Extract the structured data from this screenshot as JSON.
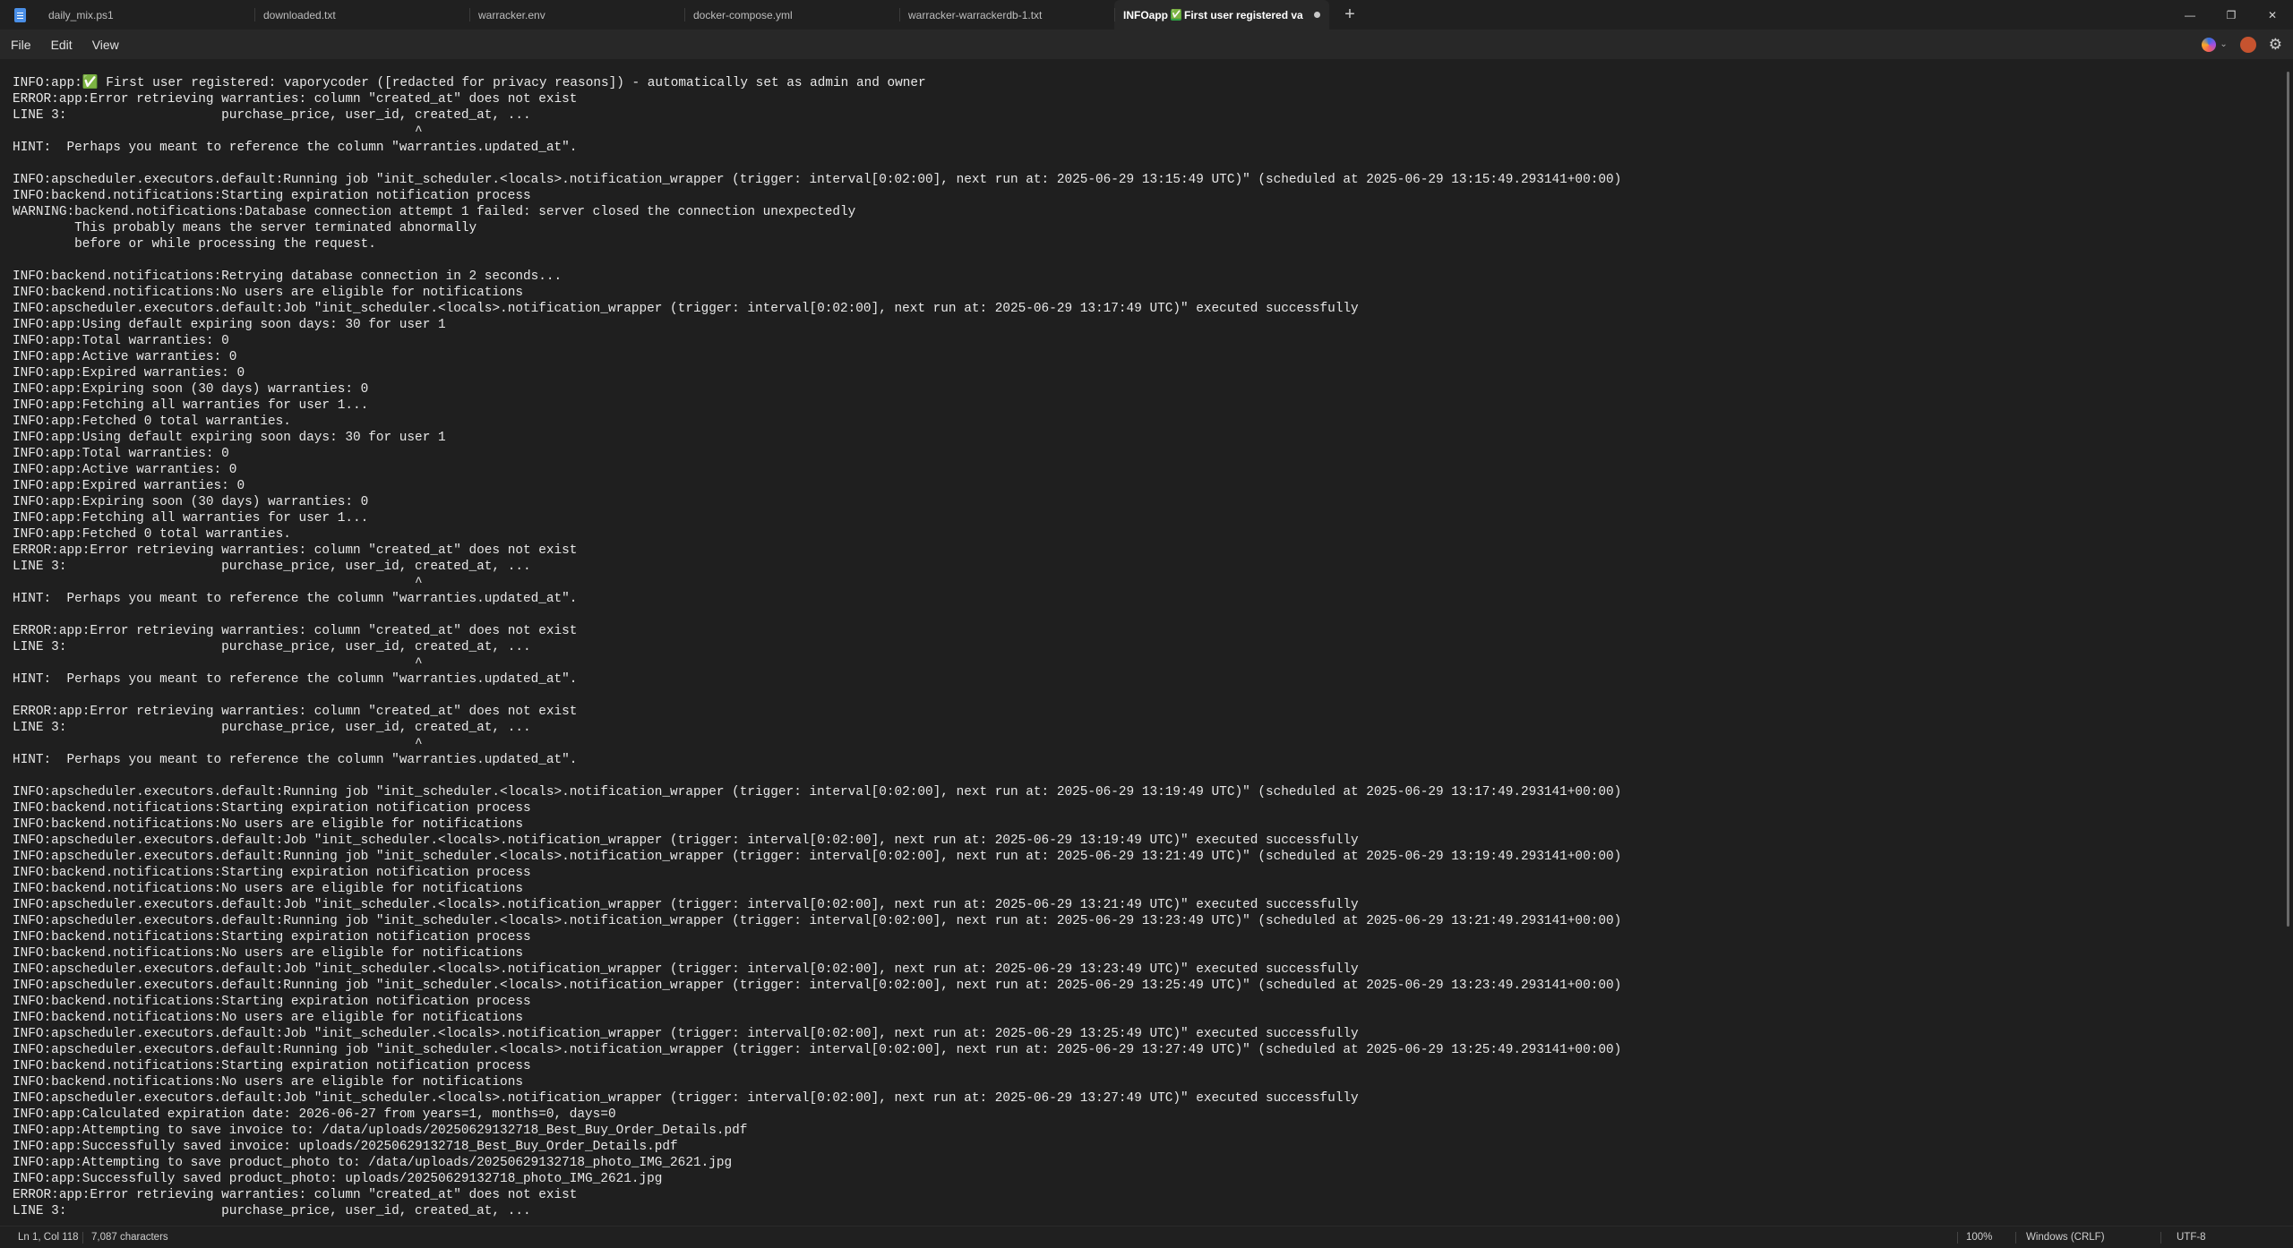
{
  "tabs": [
    {
      "label": "daily_mix.ps1"
    },
    {
      "label": "downloaded.txt"
    },
    {
      "label": "warracker.env"
    },
    {
      "label": "docker-compose.yml"
    },
    {
      "label": "warracker-warrackerdb-1.txt"
    }
  ],
  "active_tab": {
    "prefix": "INFOapp",
    "check": "✅",
    "suffix": "First user registered va"
  },
  "new_tab": "+",
  "window_controls": {
    "minimize": "—",
    "maximize": "❐",
    "close": "✕"
  },
  "menu": {
    "file": "File",
    "edit": "Edit",
    "view": "View"
  },
  "icons": {
    "app": "notepad-icon",
    "copilot": "copilot-icon",
    "account": "avatar-icon",
    "settings": "gear-icon"
  },
  "editor": {
    "lines": [
      "INFO:app:✅ First user registered: vaporycoder ([redacted for privacy reasons]) - automatically set as admin and owner",
      "ERROR:app:Error retrieving warranties: column \"created_at\" does not exist",
      "LINE 3:                    purchase_price, user_id, created_at, ...",
      "                                                    ^",
      "HINT:  Perhaps you meant to reference the column \"warranties.updated_at\".",
      "",
      "INFO:apscheduler.executors.default:Running job \"init_scheduler.<locals>.notification_wrapper (trigger: interval[0:02:00], next run at: 2025-06-29 13:15:49 UTC)\" (scheduled at 2025-06-29 13:15:49.293141+00:00)",
      "INFO:backend.notifications:Starting expiration notification process",
      "WARNING:backend.notifications:Database connection attempt 1 failed: server closed the connection unexpectedly",
      "        This probably means the server terminated abnormally",
      "        before or while processing the request.",
      "",
      "INFO:backend.notifications:Retrying database connection in 2 seconds...",
      "INFO:backend.notifications:No users are eligible for notifications",
      "INFO:apscheduler.executors.default:Job \"init_scheduler.<locals>.notification_wrapper (trigger: interval[0:02:00], next run at: 2025-06-29 13:17:49 UTC)\" executed successfully",
      "INFO:app:Using default expiring soon days: 30 for user 1",
      "INFO:app:Total warranties: 0",
      "INFO:app:Active warranties: 0",
      "INFO:app:Expired warranties: 0",
      "INFO:app:Expiring soon (30 days) warranties: 0",
      "INFO:app:Fetching all warranties for user 1...",
      "INFO:app:Fetched 0 total warranties.",
      "INFO:app:Using default expiring soon days: 30 for user 1",
      "INFO:app:Total warranties: 0",
      "INFO:app:Active warranties: 0",
      "INFO:app:Expired warranties: 0",
      "INFO:app:Expiring soon (30 days) warranties: 0",
      "INFO:app:Fetching all warranties for user 1...",
      "INFO:app:Fetched 0 total warranties.",
      "ERROR:app:Error retrieving warranties: column \"created_at\" does not exist",
      "LINE 3:                    purchase_price, user_id, created_at, ...",
      "                                                    ^",
      "HINT:  Perhaps you meant to reference the column \"warranties.updated_at\".",
      "",
      "ERROR:app:Error retrieving warranties: column \"created_at\" does not exist",
      "LINE 3:                    purchase_price, user_id, created_at, ...",
      "                                                    ^",
      "HINT:  Perhaps you meant to reference the column \"warranties.updated_at\".",
      "",
      "ERROR:app:Error retrieving warranties: column \"created_at\" does not exist",
      "LINE 3:                    purchase_price, user_id, created_at, ...",
      "                                                    ^",
      "HINT:  Perhaps you meant to reference the column \"warranties.updated_at\".",
      "",
      "INFO:apscheduler.executors.default:Running job \"init_scheduler.<locals>.notification_wrapper (trigger: interval[0:02:00], next run at: 2025-06-29 13:19:49 UTC)\" (scheduled at 2025-06-29 13:17:49.293141+00:00)",
      "INFO:backend.notifications:Starting expiration notification process",
      "INFO:backend.notifications:No users are eligible for notifications",
      "INFO:apscheduler.executors.default:Job \"init_scheduler.<locals>.notification_wrapper (trigger: interval[0:02:00], next run at: 2025-06-29 13:19:49 UTC)\" executed successfully",
      "INFO:apscheduler.executors.default:Running job \"init_scheduler.<locals>.notification_wrapper (trigger: interval[0:02:00], next run at: 2025-06-29 13:21:49 UTC)\" (scheduled at 2025-06-29 13:19:49.293141+00:00)",
      "INFO:backend.notifications:Starting expiration notification process",
      "INFO:backend.notifications:No users are eligible for notifications",
      "INFO:apscheduler.executors.default:Job \"init_scheduler.<locals>.notification_wrapper (trigger: interval[0:02:00], next run at: 2025-06-29 13:21:49 UTC)\" executed successfully",
      "INFO:apscheduler.executors.default:Running job \"init_scheduler.<locals>.notification_wrapper (trigger: interval[0:02:00], next run at: 2025-06-29 13:23:49 UTC)\" (scheduled at 2025-06-29 13:21:49.293141+00:00)",
      "INFO:backend.notifications:Starting expiration notification process",
      "INFO:backend.notifications:No users are eligible for notifications",
      "INFO:apscheduler.executors.default:Job \"init_scheduler.<locals>.notification_wrapper (trigger: interval[0:02:00], next run at: 2025-06-29 13:23:49 UTC)\" executed successfully",
      "INFO:apscheduler.executors.default:Running job \"init_scheduler.<locals>.notification_wrapper (trigger: interval[0:02:00], next run at: 2025-06-29 13:25:49 UTC)\" (scheduled at 2025-06-29 13:23:49.293141+00:00)",
      "INFO:backend.notifications:Starting expiration notification process",
      "INFO:backend.notifications:No users are eligible for notifications",
      "INFO:apscheduler.executors.default:Job \"init_scheduler.<locals>.notification_wrapper (trigger: interval[0:02:00], next run at: 2025-06-29 13:25:49 UTC)\" executed successfully",
      "INFO:apscheduler.executors.default:Running job \"init_scheduler.<locals>.notification_wrapper (trigger: interval[0:02:00], next run at: 2025-06-29 13:27:49 UTC)\" (scheduled at 2025-06-29 13:25:49.293141+00:00)",
      "INFO:backend.notifications:Starting expiration notification process",
      "INFO:backend.notifications:No users are eligible for notifications",
      "INFO:apscheduler.executors.default:Job \"init_scheduler.<locals>.notification_wrapper (trigger: interval[0:02:00], next run at: 2025-06-29 13:27:49 UTC)\" executed successfully",
      "INFO:app:Calculated expiration date: 2026-06-27 from years=1, months=0, days=0",
      "INFO:app:Attempting to save invoice to: /data/uploads/20250629132718_Best_Buy_Order_Details.pdf",
      "INFO:app:Successfully saved invoice: uploads/20250629132718_Best_Buy_Order_Details.pdf",
      "INFO:app:Attempting to save product_photo to: /data/uploads/20250629132718_photo_IMG_2621.jpg",
      "INFO:app:Successfully saved product_photo: uploads/20250629132718_photo_IMG_2621.jpg",
      "ERROR:app:Error retrieving warranties: column \"created_at\" does not exist",
      "LINE 3:                    purchase_price, user_id, created_at, ..."
    ]
  },
  "status": {
    "position": "Ln 1, Col 118",
    "characters": "7,087 characters",
    "zoom": "100%",
    "line_ending": "Windows (CRLF)",
    "encoding": "UTF-8"
  },
  "colors": {
    "background": "#1f1f1f",
    "text": "#e8e8e8",
    "check": "#2ea043"
  }
}
